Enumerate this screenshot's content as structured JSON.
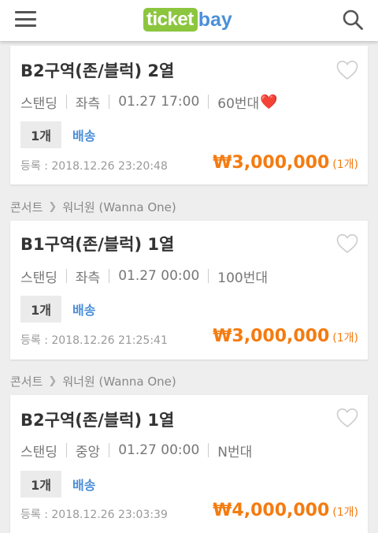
{
  "header": {
    "logo_ticket": "ticket",
    "logo_bay": "bay",
    "menu_icon": "hamburger-menu-icon",
    "search_icon": "search-icon"
  },
  "colors": {
    "logo_green": "#8cc63f",
    "logo_blue": "#4a90d9",
    "price_orange": "#f47b10",
    "delivery_blue": "#4a8ed8"
  },
  "listings": [
    {
      "title": "B2구역(존/블럭) 2열",
      "type": "스탠딩",
      "side": "좌측",
      "datetime": "01.27 17:00",
      "number": "60번대",
      "number_emoji": "❤️",
      "quantity": "1개",
      "delivery": "배송",
      "registered": "등록 : 2018.12.26 23:20:48",
      "price": "₩3,000,000",
      "price_qty": "(1개)"
    },
    {
      "category": "콘서트",
      "artist": "워너원 (Wanna One)",
      "title": "B1구역(존/블럭) 1열",
      "type": "스탠딩",
      "side": "좌측",
      "datetime": "01.27 00:00",
      "number": "100번대",
      "quantity": "1개",
      "delivery": "배송",
      "registered": "등록 : 2018.12.26 21:25:41",
      "price": "₩3,000,000",
      "price_qty": "(1개)"
    },
    {
      "category": "콘서트",
      "artist": "워너원 (Wanna One)",
      "title": "B2구역(존/블럭) 1열",
      "type": "스탠딩",
      "side": "중앙",
      "datetime": "01.27 00:00",
      "number": "N번대",
      "quantity": "1개",
      "delivery": "배송",
      "registered": "등록 : 2018.12.26 23:03:39",
      "price": "₩4,000,000",
      "price_qty": "(1개)"
    }
  ]
}
